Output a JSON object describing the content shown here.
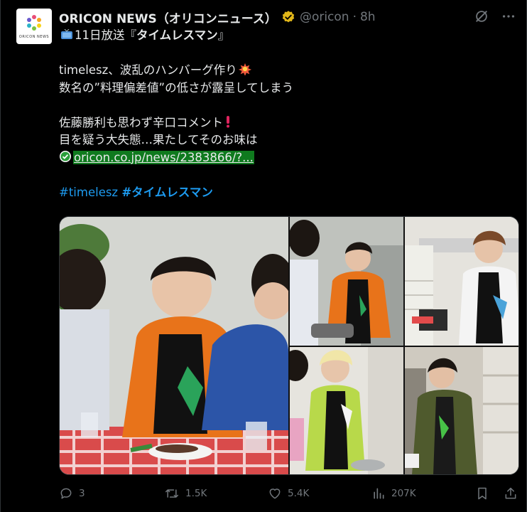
{
  "post": {
    "author_name": "ORICON NEWS（オリコンニュース）",
    "handle": "@oricon",
    "separator": "·",
    "time": "8h",
    "avatar_label": "ORICON NEWS",
    "text": {
      "line1_pre": "11日放送『",
      "line1_bold": "タイムレスマン",
      "line1_post": "』",
      "line2": "timelesz、波乱のハンバーグ作り",
      "line3": "数名の”料理偏差値”の低さが露呈してしまう",
      "line4": "佐藤勝利も思わず辛口コメント",
      "line5": "目を疑う大失態…果たしてそのお味は",
      "link": "oricon.co.jp/news/2383866/?...",
      "hashtag1": "#timelesz",
      "hashtag2": "#タイムレスマン"
    },
    "stats": {
      "replies": "3",
      "reposts": "1.5K",
      "likes": "5.4K",
      "views": "207K"
    }
  },
  "colors": {
    "background": "#000000",
    "text": "#e7e9ea",
    "muted": "#71767b",
    "accent": "#1d9bf0",
    "verified_gold": "#e2b719",
    "link_highlight": "#0f7a1e"
  },
  "icons": [
    "verified-badge-icon",
    "grok-icon",
    "more-icon",
    "tv-icon",
    "collision-icon",
    "exclamation-icon",
    "check-icon",
    "reply-icon",
    "repost-icon",
    "like-icon",
    "views-icon",
    "bookmark-icon",
    "share-icon"
  ]
}
